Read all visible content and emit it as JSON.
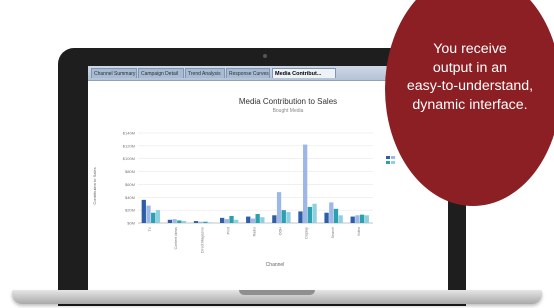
{
  "app": {
    "tabs": [
      {
        "label": "Channel Summary",
        "active": false
      },
      {
        "label": "Campaign Detail",
        "active": false
      },
      {
        "label": "Trend Analysis",
        "active": false
      },
      {
        "label": "Response Curves",
        "active": false
      },
      {
        "label": "Media Contribut...",
        "active": true
      }
    ]
  },
  "chart_data": {
    "type": "bar",
    "title": "Media Contribution to Sales",
    "subtitle": "Bought Media",
    "xlabel": "Channel",
    "ylabel": "Contribution to Sales",
    "ylim": [
      0,
      140
    ],
    "yticks": [
      "$0M",
      "$20M",
      "$40M",
      "$60M",
      "$80M",
      "$100M",
      "$120M",
      "$140M"
    ],
    "categories": [
      "TV",
      "Content Ideas",
      "Direct Magazine",
      "Print",
      "Radio",
      "OOH",
      "Display",
      "Search",
      "Video"
    ],
    "series": [
      {
        "values": [
          36,
          5,
          3,
          8,
          10,
          12,
          18,
          16,
          10
        ]
      },
      {
        "values": [
          27,
          6,
          2,
          6,
          7,
          48,
          122,
          32,
          12
        ]
      },
      {
        "values": [
          16,
          4,
          2,
          11,
          14,
          20,
          25,
          22,
          13
        ]
      },
      {
        "values": [
          20,
          3,
          1,
          5,
          9,
          17,
          30,
          12,
          12
        ]
      }
    ],
    "colors": [
      "#2e5fa6",
      "#9db8e6",
      "#2aa0b0",
      "#8fd0e0"
    ],
    "legend": "right"
  },
  "overlay": {
    "lines": [
      "You receive",
      "output in an",
      "easy-to-understand,",
      "dynamic interface."
    ],
    "color": "#8b1f23"
  }
}
